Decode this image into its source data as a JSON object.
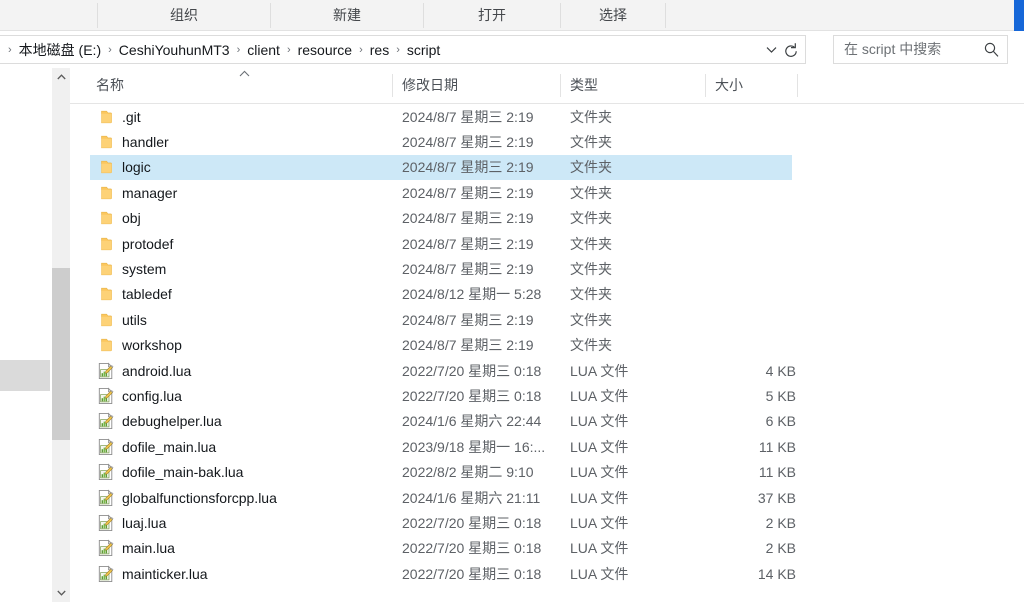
{
  "window": {
    "accent_color": "#1667d8",
    "selection_color": "#cde8f7"
  },
  "command_bar": {
    "items": [
      {
        "label": "组织",
        "name": "organize"
      },
      {
        "label": "新建",
        "name": "new"
      },
      {
        "label": "打开",
        "name": "open"
      },
      {
        "label": "选择",
        "name": "select"
      }
    ]
  },
  "address_bar": {
    "breadcrumbs": [
      "本地磁盘 (E:)",
      "CeshiYouhunMT3",
      "client",
      "resource",
      "res",
      "script"
    ],
    "separator": "›",
    "dropdown_icon": "chevron-down-icon",
    "refresh_icon": "refresh-icon"
  },
  "search": {
    "placeholder": "在 script 中搜索",
    "icon": "search-icon"
  },
  "columns": {
    "name": "名称",
    "date_modified": "修改日期",
    "type": "类型",
    "size": "大小",
    "sort_indicator": "⌃"
  },
  "scrollbar": {
    "up_arrow": "⌃",
    "down_arrow": "⌄"
  },
  "files": [
    {
      "name": ".git",
      "date": "2024/8/7 星期三 2:19",
      "type": "文件夹",
      "size": "",
      "icon": "folder-icon",
      "selected": false
    },
    {
      "name": "handler",
      "date": "2024/8/7 星期三 2:19",
      "type": "文件夹",
      "size": "",
      "icon": "folder-icon",
      "selected": false
    },
    {
      "name": "logic",
      "date": "2024/8/7 星期三 2:19",
      "type": "文件夹",
      "size": "",
      "icon": "folder-icon",
      "selected": true
    },
    {
      "name": "manager",
      "date": "2024/8/7 星期三 2:19",
      "type": "文件夹",
      "size": "",
      "icon": "folder-icon",
      "selected": false
    },
    {
      "name": "obj",
      "date": "2024/8/7 星期三 2:19",
      "type": "文件夹",
      "size": "",
      "icon": "folder-icon",
      "selected": false
    },
    {
      "name": "protodef",
      "date": "2024/8/7 星期三 2:19",
      "type": "文件夹",
      "size": "",
      "icon": "folder-icon",
      "selected": false
    },
    {
      "name": "system",
      "date": "2024/8/7 星期三 2:19",
      "type": "文件夹",
      "size": "",
      "icon": "folder-icon",
      "selected": false
    },
    {
      "name": "tabledef",
      "date": "2024/8/12 星期一 5:28",
      "type": "文件夹",
      "size": "",
      "icon": "folder-icon",
      "selected": false
    },
    {
      "name": "utils",
      "date": "2024/8/7 星期三 2:19",
      "type": "文件夹",
      "size": "",
      "icon": "folder-icon",
      "selected": false
    },
    {
      "name": "workshop",
      "date": "2024/8/7 星期三 2:19",
      "type": "文件夹",
      "size": "",
      "icon": "folder-icon",
      "selected": false
    },
    {
      "name": "android.lua",
      "date": "2022/7/20 星期三 0:18",
      "type": "LUA 文件",
      "size": "4 KB",
      "icon": "lua-file-icon",
      "selected": false
    },
    {
      "name": "config.lua",
      "date": "2022/7/20 星期三 0:18",
      "type": "LUA 文件",
      "size": "5 KB",
      "icon": "lua-file-icon",
      "selected": false
    },
    {
      "name": "debughelper.lua",
      "date": "2024/1/6 星期六 22:44",
      "type": "LUA 文件",
      "size": "6 KB",
      "icon": "lua-file-icon",
      "selected": false
    },
    {
      "name": "dofile_main.lua",
      "date": "2023/9/18 星期一 16:...",
      "type": "LUA 文件",
      "size": "11 KB",
      "icon": "lua-file-icon",
      "selected": false
    },
    {
      "name": "dofile_main-bak.lua",
      "date": "2022/8/2 星期二 9:10",
      "type": "LUA 文件",
      "size": "11 KB",
      "icon": "lua-file-icon",
      "selected": false
    },
    {
      "name": "globalfunctionsforcpp.lua",
      "date": "2024/1/6 星期六 21:11",
      "type": "LUA 文件",
      "size": "37 KB",
      "icon": "lua-file-icon",
      "selected": false
    },
    {
      "name": "luaj.lua",
      "date": "2022/7/20 星期三 0:18",
      "type": "LUA 文件",
      "size": "2 KB",
      "icon": "lua-file-icon",
      "selected": false
    },
    {
      "name": "main.lua",
      "date": "2022/7/20 星期三 0:18",
      "type": "LUA 文件",
      "size": "2 KB",
      "icon": "lua-file-icon",
      "selected": false
    },
    {
      "name": "mainticker.lua",
      "date": "2022/7/20 星期三 0:18",
      "type": "LUA 文件",
      "size": "14 KB",
      "icon": "lua-file-icon",
      "selected": false
    }
  ]
}
